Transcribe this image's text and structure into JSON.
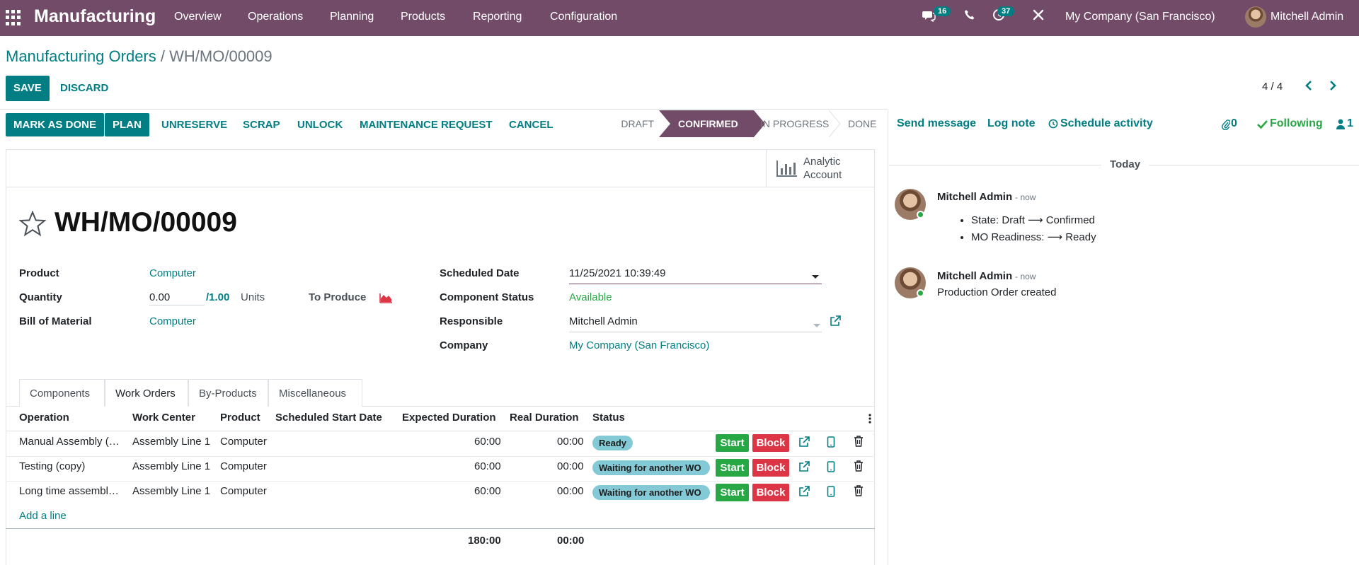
{
  "navbar": {
    "app_name": "Manufacturing",
    "menu": [
      "Overview",
      "Operations",
      "Planning",
      "Products",
      "Reporting",
      "Configuration"
    ],
    "messages_count": "16",
    "activities_count": "37",
    "company": "My Company (San Francisco)",
    "user": "Mitchell Admin"
  },
  "breadcrumb": {
    "parent": "Manufacturing Orders",
    "separator": "/",
    "current": "WH/MO/00009"
  },
  "control": {
    "save": "SAVE",
    "discard": "DISCARD",
    "pager": "4 / 4"
  },
  "actions": {
    "mark_done": "MARK AS DONE",
    "plan": "PLAN",
    "unreserve": "UNRESERVE",
    "scrap": "SCRAP",
    "unlock": "UNLOCK",
    "maintenance": "MAINTENANCE REQUEST",
    "cancel": "CANCEL"
  },
  "stages": [
    "DRAFT",
    "CONFIRMED",
    "IN PROGRESS",
    "DONE"
  ],
  "current_stage": "CONFIRMED",
  "smart_button": {
    "line1": "Analytic",
    "line2": "Account"
  },
  "form": {
    "title": "WH/MO/00009",
    "product_label": "Product",
    "product": "Computer",
    "quantity_label": "Quantity",
    "quantity": "0.00",
    "quantity_total": "/1.00",
    "uom": "Units",
    "to_produce": "To Produce",
    "bom_label": "Bill of Material",
    "bom": "Computer",
    "scheduled_label": "Scheduled Date",
    "scheduled": "11/25/2021 10:39:49",
    "component_status_label": "Component Status",
    "component_status": "Available",
    "responsible_label": "Responsible",
    "responsible": "Mitchell Admin",
    "company_label": "Company",
    "company": "My Company (San Francisco)"
  },
  "tabs": [
    "Components",
    "Work Orders",
    "By-Products",
    "Miscellaneous"
  ],
  "active_tab": "Work Orders",
  "table": {
    "headers": [
      "Operation",
      "Work Center",
      "Product",
      "Scheduled Start Date",
      "Expected Duration",
      "Real Duration",
      "Status"
    ],
    "rows": [
      {
        "operation": "Manual Assembly (copy)",
        "center": "Assembly Line 1",
        "product": "Computer",
        "expected": "60:00",
        "real": "00:00",
        "status": "Ready",
        "start": "Start",
        "block": "Block"
      },
      {
        "operation": "Testing (copy)",
        "center": "Assembly Line 1",
        "product": "Computer",
        "expected": "60:00",
        "real": "00:00",
        "status": "Waiting for another WO",
        "start": "Start",
        "block": "Block"
      },
      {
        "operation": "Long time assembly (copy)",
        "center": "Assembly Line 1",
        "product": "Computer",
        "expected": "60:00",
        "real": "00:00",
        "status": "Waiting for another WO",
        "start": "Start",
        "block": "Block"
      }
    ],
    "add_line": "Add a line",
    "total_expected": "180:00",
    "total_real": "00:00"
  },
  "chatter": {
    "send_message": "Send message",
    "log_note": "Log note",
    "schedule_activity": "Schedule activity",
    "attachments": "0",
    "following": "Following",
    "followers": "1",
    "today": "Today",
    "messages": [
      {
        "author": "Mitchell Admin",
        "when": "- now",
        "lines": [
          "State: Draft ⟶ Confirmed",
          "MO Readiness: ⟶ Ready"
        ]
      },
      {
        "author": "Mitchell Admin",
        "when": "- now",
        "body": "Production Order created"
      }
    ]
  },
  "colors": {
    "brand": "#714B67",
    "primary": "#017e84",
    "success": "#28a745",
    "danger": "#dc3545",
    "info": "#83c9d6"
  }
}
